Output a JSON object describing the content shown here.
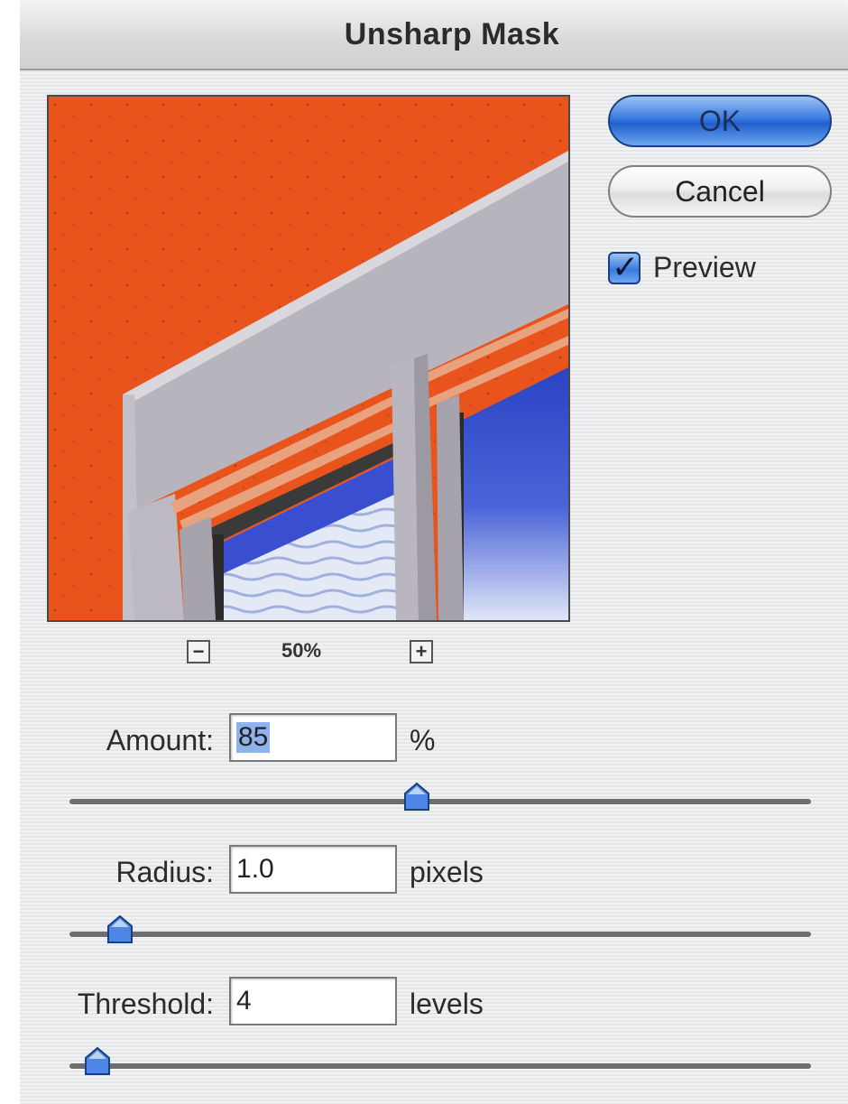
{
  "dialog": {
    "title": "Unsharp Mask"
  },
  "buttons": {
    "ok_label": "OK",
    "cancel_label": "Cancel"
  },
  "preview_toggle": {
    "label": "Preview",
    "checked": true
  },
  "zoom": {
    "level": "50%",
    "minus_icon": "zoom-out-icon",
    "plus_icon": "zoom-in-icon"
  },
  "amount": {
    "label": "Amount:",
    "value": "85",
    "unit": "%",
    "slider_fraction": 0.45
  },
  "radius": {
    "label": "Radius:",
    "value": "1.0",
    "unit": "pixels",
    "slider_fraction": 0.05
  },
  "threshold": {
    "label": "Threshold:",
    "value": "4",
    "unit": "levels",
    "slider_fraction": 0.02
  },
  "colors": {
    "accent_blue": "#3a7ae0",
    "wall_orange": "#e8541c",
    "window_blue": "#2f48c9"
  }
}
